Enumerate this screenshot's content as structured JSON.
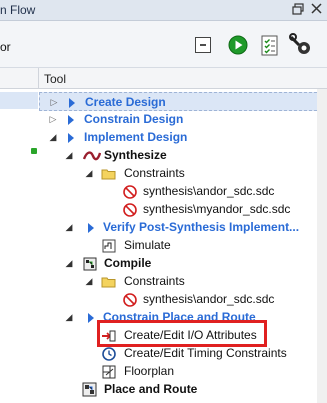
{
  "window": {
    "title": "n Flow",
    "module": "or"
  },
  "toolbar": {
    "collapse_icon": "minus-box-icon",
    "run_icon": "green-play-icon",
    "report_icon": "checklist-report-icon",
    "options_icon": "wrench-gear-icon"
  },
  "header": {
    "tool_column": "Tool"
  },
  "tree": [
    {
      "label": "Create Design",
      "style": "link",
      "icon": "blue-arrow-icon",
      "expander": "closed"
    },
    {
      "label": "Constrain Design",
      "style": "link",
      "icon": "blue-arrow-icon",
      "expander": "closed"
    },
    {
      "label": "Implement Design",
      "style": "link",
      "icon": "blue-arrow-icon",
      "expander": "open"
    },
    {
      "label": "Synthesize",
      "style": "bold",
      "icon": "synthesize-icon",
      "expander": "open"
    },
    {
      "label": "Constraints",
      "style": "normal",
      "icon": "folder-icon",
      "expander": "open"
    },
    {
      "label": "synthesis\\andor_sdc.sdc",
      "style": "normal",
      "icon": "no-entry-icon",
      "expander": "none"
    },
    {
      "label": "synthesis\\myandor_sdc.sdc",
      "style": "normal",
      "icon": "no-entry-icon",
      "expander": "none"
    },
    {
      "label": "Verify Post-Synthesis Implement...",
      "style": "link",
      "icon": "blue-arrow-icon",
      "expander": "open"
    },
    {
      "label": "Simulate",
      "style": "normal",
      "icon": "simulate-icon",
      "expander": "none"
    },
    {
      "label": "Compile",
      "style": "bold",
      "icon": "compile-icon",
      "expander": "open"
    },
    {
      "label": "Constraints",
      "style": "normal",
      "icon": "folder-icon",
      "expander": "open"
    },
    {
      "label": "synthesis\\andor_sdc.sdc",
      "style": "normal",
      "icon": "no-entry-icon",
      "expander": "none"
    },
    {
      "label": "Constrain Place and Route",
      "style": "link",
      "icon": "blue-arrow-icon",
      "expander": "open"
    },
    {
      "label": "Create/Edit I/O Attributes",
      "style": "normal",
      "icon": "io-attributes-icon",
      "expander": "none"
    },
    {
      "label": "Create/Edit Timing Constraints",
      "style": "normal",
      "icon": "clock-icon",
      "expander": "none"
    },
    {
      "label": "Floorplan",
      "style": "normal",
      "icon": "floorplan-icon",
      "expander": "none"
    },
    {
      "label": "Place and Route",
      "style": "bold",
      "icon": "place-route-icon",
      "expander": "none"
    }
  ],
  "colors": {
    "link": "#2a6bd6",
    "selection": "#dbe6f6",
    "highlight": "#e02020"
  }
}
